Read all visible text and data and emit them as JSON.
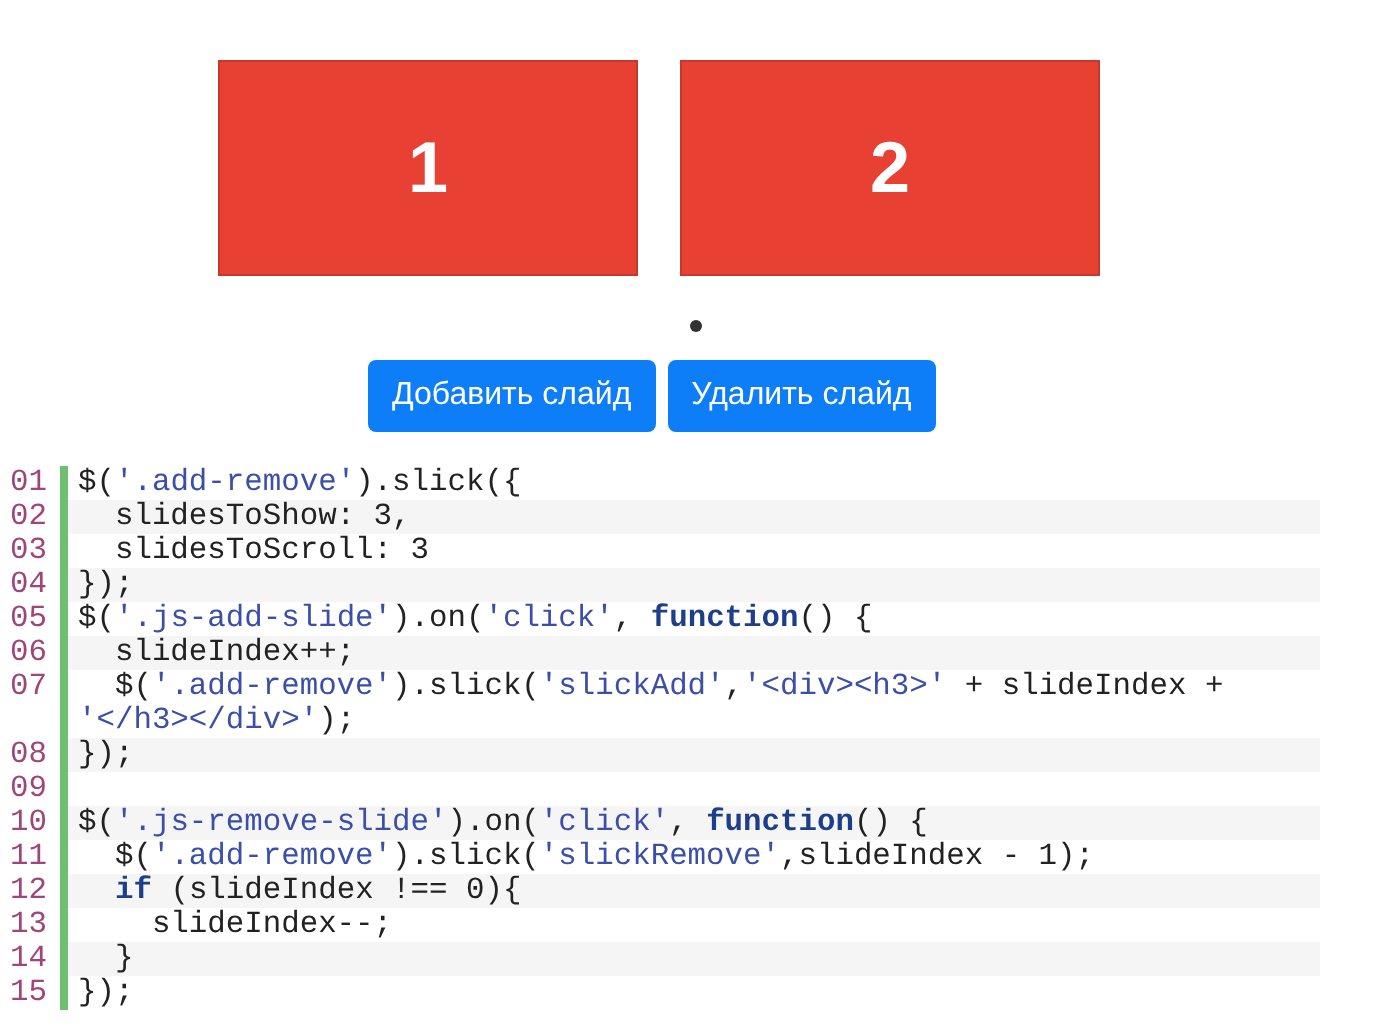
{
  "slides": [
    {
      "label": "1"
    },
    {
      "label": "2"
    }
  ],
  "dots": [
    {
      "selected": true
    }
  ],
  "buttons": [
    {
      "label": "Добавить слайд"
    },
    {
      "label": "Удалить слайд"
    }
  ],
  "code": [
    {
      "number": "01",
      "rows": [
        [
          {
            "kind": "plain",
            "text": "$("
          },
          {
            "kind": "string",
            "text": "'.add-remove'"
          },
          {
            "kind": "plain",
            "text": ").slick({"
          }
        ]
      ]
    },
    {
      "number": "02",
      "rows": [
        [
          {
            "kind": "plain",
            "text": "  slidesToShow: 3,"
          }
        ]
      ]
    },
    {
      "number": "03",
      "rows": [
        [
          {
            "kind": "plain",
            "text": "  slidesToScroll: 3"
          }
        ]
      ]
    },
    {
      "number": "04",
      "rows": [
        [
          {
            "kind": "plain",
            "text": "});"
          }
        ]
      ]
    },
    {
      "number": "05",
      "rows": [
        [
          {
            "kind": "plain",
            "text": "$("
          },
          {
            "kind": "string",
            "text": "'.js-add-slide'"
          },
          {
            "kind": "plain",
            "text": ").on("
          },
          {
            "kind": "string",
            "text": "'click'"
          },
          {
            "kind": "plain",
            "text": ", "
          },
          {
            "kind": "keyword",
            "text": "function"
          },
          {
            "kind": "plain",
            "text": "() {"
          }
        ]
      ]
    },
    {
      "number": "06",
      "rows": [
        [
          {
            "kind": "plain",
            "text": "  slideIndex++;"
          }
        ]
      ]
    },
    {
      "number": "07",
      "rows": [
        [
          {
            "kind": "plain",
            "text": "  $("
          },
          {
            "kind": "string",
            "text": "'.add-remove'"
          },
          {
            "kind": "plain",
            "text": ").slick("
          },
          {
            "kind": "string",
            "text": "'slickAdd'"
          },
          {
            "kind": "plain",
            "text": ","
          },
          {
            "kind": "string",
            "text": "'<div><h3>'"
          },
          {
            "kind": "plain",
            "text": " + slideIndex +"
          }
        ],
        [
          {
            "kind": "string",
            "text": "'</h3></div>'"
          },
          {
            "kind": "plain",
            "text": ");"
          }
        ]
      ]
    },
    {
      "number": "08",
      "rows": [
        [
          {
            "kind": "plain",
            "text": "});"
          }
        ]
      ]
    },
    {
      "number": "09",
      "rows": [
        []
      ]
    },
    {
      "number": "10",
      "rows": [
        [
          {
            "kind": "plain",
            "text": "$("
          },
          {
            "kind": "string",
            "text": "'.js-remove-slide'"
          },
          {
            "kind": "plain",
            "text": ").on("
          },
          {
            "kind": "string",
            "text": "'click'"
          },
          {
            "kind": "plain",
            "text": ", "
          },
          {
            "kind": "keyword",
            "text": "function"
          },
          {
            "kind": "plain",
            "text": "() {"
          }
        ]
      ]
    },
    {
      "number": "11",
      "rows": [
        [
          {
            "kind": "plain",
            "text": "  $("
          },
          {
            "kind": "string",
            "text": "'.add-remove'"
          },
          {
            "kind": "plain",
            "text": ").slick("
          },
          {
            "kind": "string",
            "text": "'slickRemove'"
          },
          {
            "kind": "plain",
            "text": ",slideIndex - 1);"
          }
        ]
      ]
    },
    {
      "number": "12",
      "rows": [
        [
          {
            "kind": "plain",
            "text": "  "
          },
          {
            "kind": "keyword",
            "text": "if"
          },
          {
            "kind": "plain",
            "text": " (slideIndex !== 0){"
          }
        ]
      ]
    },
    {
      "number": "13",
      "rows": [
        [
          {
            "kind": "plain",
            "text": "    slideIndex--;"
          }
        ]
      ]
    },
    {
      "number": "14",
      "rows": [
        [
          {
            "kind": "plain",
            "text": "  }"
          }
        ]
      ]
    },
    {
      "number": "15",
      "rows": [
        [
          {
            "kind": "plain",
            "text": "});"
          }
        ]
      ]
    }
  ]
}
